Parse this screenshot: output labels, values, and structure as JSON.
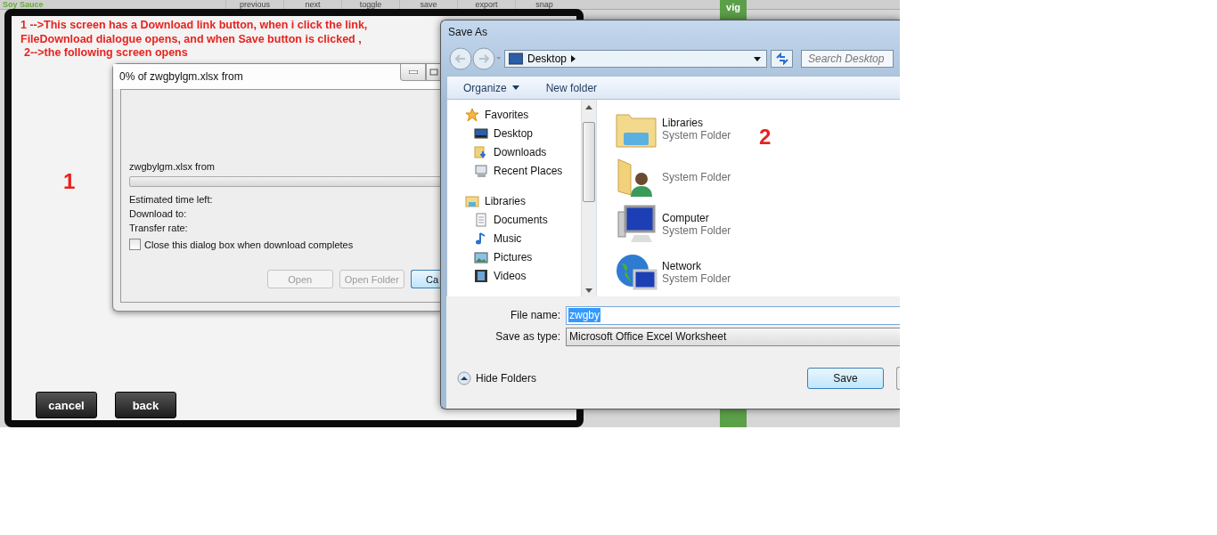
{
  "background": {
    "top_bar": {
      "title": "Soy Sauce",
      "buttons": [
        "previous",
        "next",
        "toggle",
        "save",
        "export",
        "snap"
      ]
    },
    "side_tab": "vig"
  },
  "page": {
    "annotation_lines": [
      "1 -->This screen has a Download link button, when i click the link,",
      "FileDownload dialogue opens, and when Save button is clicked ,",
      "2-->the following screen opens"
    ],
    "marker": "1",
    "buttons": [
      "cancel",
      "back"
    ]
  },
  "download_dialog": {
    "title": "0% of zwgbylgm.xlsx from",
    "file_line": "zwgbylgm.xlsx from",
    "progress": {
      "level": 0
    },
    "fields": [
      "Estimated time left:",
      "Download to:",
      "Transfer rate:"
    ],
    "close_when_done": {
      "label": "Close this dialog box when download completes",
      "checked": false
    },
    "buttons": [
      {
        "label": "Open",
        "disabled": true
      },
      {
        "label": "Open Folder",
        "disabled": true
      },
      {
        "label": "Ca",
        "disabled": false
      }
    ]
  },
  "save_as": {
    "title": "Save As",
    "address": "Desktop",
    "search_placeholder": "Search Desktop",
    "toolbar": [
      {
        "label": "Organize",
        "kind": "menu"
      },
      {
        "label": "New folder",
        "kind": "button"
      }
    ],
    "nav_tree": [
      {
        "label": "Favorites",
        "kind": "star",
        "children": [
          {
            "label": "Desktop",
            "kind": "desktop"
          },
          {
            "label": "Downloads",
            "kind": "downloads"
          },
          {
            "label": "Recent Places",
            "kind": "recent"
          }
        ]
      },
      {
        "label": "Libraries",
        "kind": "library",
        "children": [
          {
            "label": "Documents",
            "kind": "document"
          },
          {
            "label": "Music",
            "kind": "music"
          },
          {
            "label": "Pictures",
            "kind": "pictures"
          },
          {
            "label": "Videos",
            "kind": "videos"
          }
        ]
      }
    ],
    "items": [
      {
        "name": "Libraries",
        "type": "System Folder",
        "kind": "library"
      },
      {
        "type": "System Folder",
        "kind": "user"
      },
      {
        "name": "Computer",
        "type": "System Folder",
        "kind": "computer"
      },
      {
        "name": "Network",
        "type": "System Folder",
        "kind": "network"
      }
    ],
    "marker": "2",
    "file_name_label": "File name:",
    "file_name": "zwgby",
    "save_type_label": "Save as type:",
    "save_type": "Microsoft Office Excel Worksheet",
    "hide_folders": "Hide Folders",
    "buttons": [
      "Save"
    ]
  }
}
